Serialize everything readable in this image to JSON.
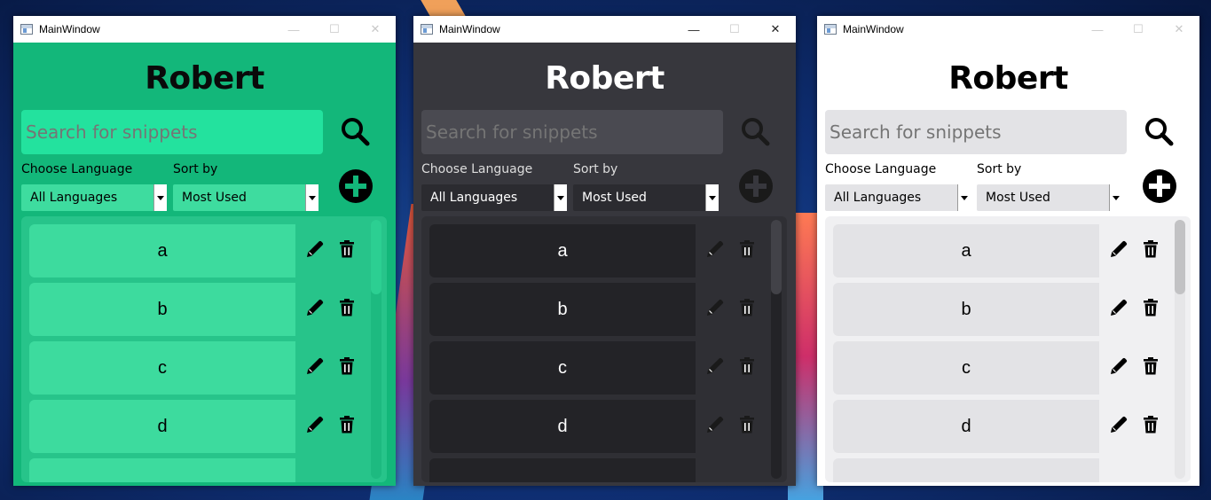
{
  "windows": [
    {
      "theme": "green",
      "title": "MainWindow",
      "username": "Robert",
      "search_placeholder": "Search for snippets",
      "choose_language_label": "Choose Language",
      "sort_by_label": "Sort by",
      "language_selected": "All Languages",
      "sort_selected": "Most Used",
      "snippets": [
        "a",
        "b",
        "c",
        "d"
      ],
      "icon_color": "#000000"
    },
    {
      "theme": "dark",
      "title": "MainWindow",
      "username": "Robert",
      "search_placeholder": "Search for snippets",
      "choose_language_label": "Choose Language",
      "sort_by_label": "Sort by",
      "language_selected": "All Languages",
      "sort_selected": "Most Used",
      "snippets": [
        "a",
        "b",
        "c",
        "d"
      ],
      "icon_color": "#1a1a1a"
    },
    {
      "theme": "light",
      "title": "MainWindow",
      "username": "Robert",
      "search_placeholder": "Search for snippets",
      "choose_language_label": "Choose Language",
      "sort_by_label": "Sort by",
      "language_selected": "All Languages",
      "sort_selected": "Most Used",
      "snippets": [
        "a",
        "b",
        "c",
        "d"
      ],
      "icon_color": "#000000"
    }
  ],
  "icons": {
    "minimize": "minimize-icon",
    "maximize": "maximize-icon",
    "close": "close-icon",
    "search": "search-icon",
    "add": "plus-circle-icon",
    "edit": "pencil-icon",
    "delete": "trash-icon"
  }
}
